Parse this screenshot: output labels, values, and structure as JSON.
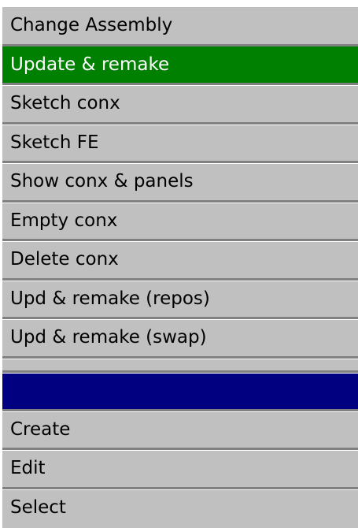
{
  "colors": {
    "background": "#c0c0c0",
    "selected": "#008000",
    "header": "#000080",
    "separator": "#808080"
  },
  "menu": {
    "top_items": [
      "Change Assembly",
      "Update & remake",
      "Sketch conx",
      "Sketch FE",
      "Show conx & panels",
      "Empty conx",
      "Delete conx",
      "Upd & remake (repos)",
      "Upd & remake (swap)"
    ],
    "bottom_items": [
      "Create",
      "Edit",
      "Select"
    ]
  }
}
